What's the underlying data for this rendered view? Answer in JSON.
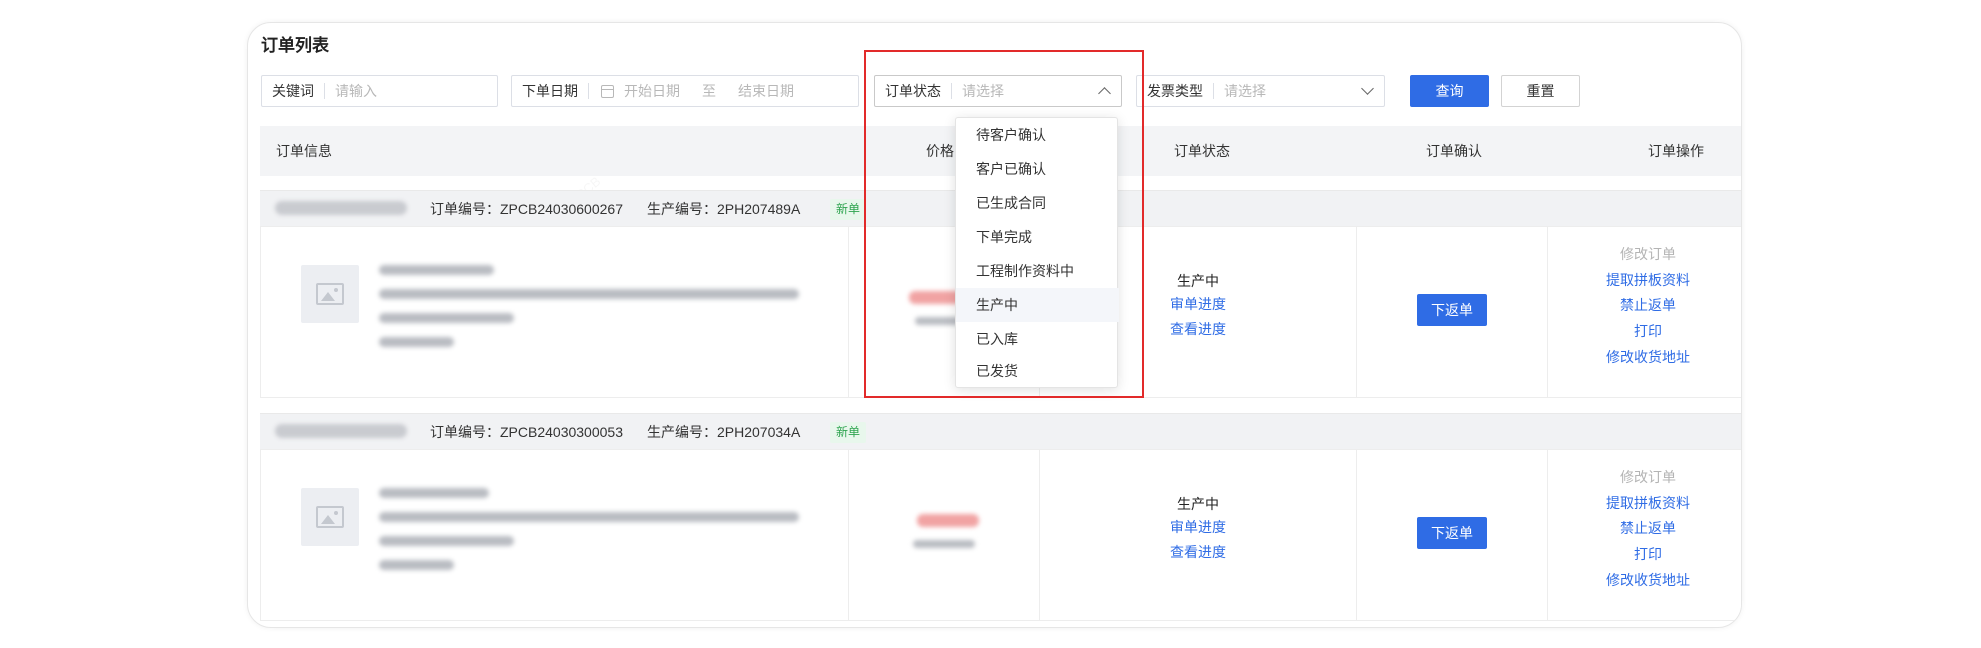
{
  "page_title": "订单列表",
  "filters": {
    "keyword": {
      "label": "关键词",
      "placeholder": "请输入"
    },
    "order_date": {
      "label": "下单日期",
      "start_placeholder": "开始日期",
      "separator": "至",
      "end_placeholder": "结束日期"
    },
    "order_status": {
      "label": "订单状态",
      "placeholder": "请选择"
    },
    "invoice_type": {
      "label": "发票类型",
      "placeholder": "请选择"
    },
    "query_label": "查询",
    "reset_label": "重置"
  },
  "table_headers": [
    "订单信息",
    "价格",
    "订单状态",
    "订单确认",
    "订单操作"
  ],
  "status_dropdown": {
    "options": [
      "待客户确认",
      "客户已确认",
      "已生成合同",
      "下单完成",
      "工程制作资料中",
      "生产中",
      "已入库",
      "已发货"
    ],
    "hovered": "生产中"
  },
  "orders": [
    {
      "order_no": "订单编号：ZPCB24030600267",
      "production_no": "生产编号：2PH207489A",
      "badge": "新单",
      "status": "生产中",
      "review_link": "审单进度",
      "progress_link": "查看进度",
      "confirm_button": "下返单",
      "actions": [
        "修改订单",
        "提取拼板资料",
        "禁止返单",
        "打印",
        "修改收货地址"
      ]
    },
    {
      "order_no": "订单编号：ZPCB24030300053",
      "production_no": "生产编号：2PH207034A",
      "badge": "新单",
      "status": "生产中",
      "review_link": "审单进度",
      "progress_link": "查看进度",
      "confirm_button": "下返单",
      "actions": [
        "修改订单",
        "提取拼板资料",
        "禁止返单",
        "打印",
        "修改收货地址"
      ]
    }
  ],
  "colors": {
    "primary": "#2f6ce5",
    "highlight_border": "#e22a2a",
    "badge_text": "#2ea44f"
  }
}
